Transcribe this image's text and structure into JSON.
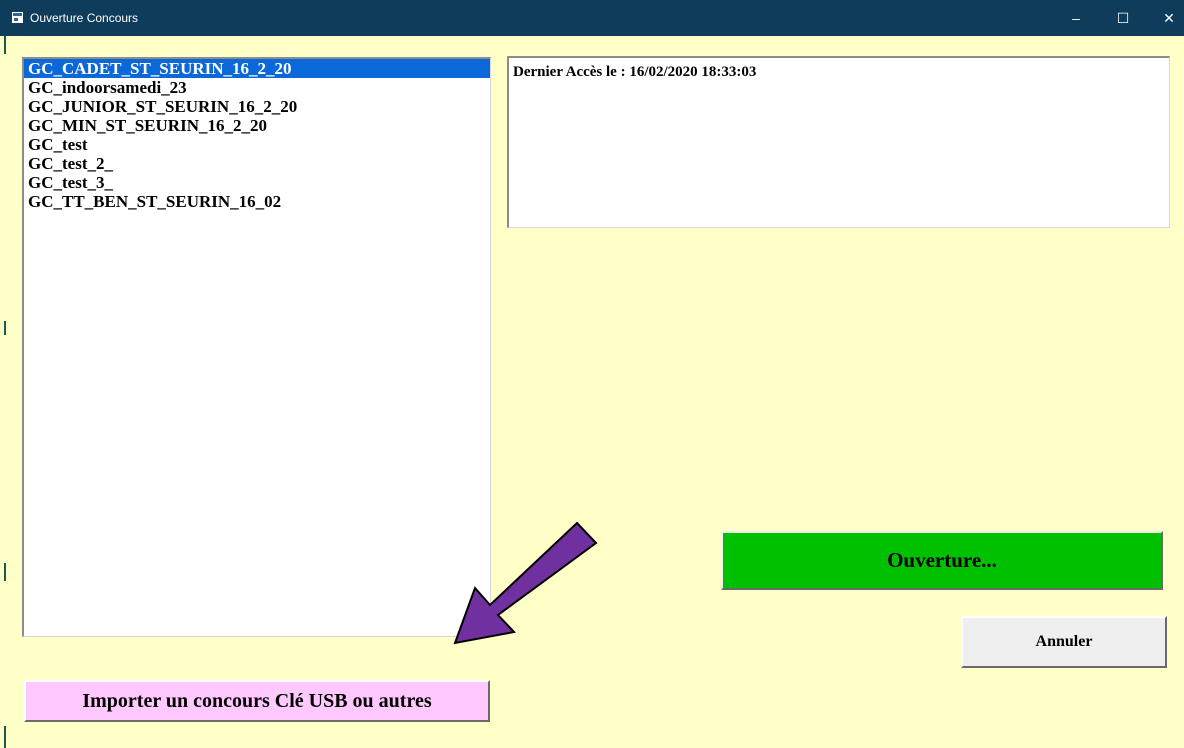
{
  "window": {
    "title": "Ouverture Concours",
    "minimize_glyph": "–",
    "maximize_glyph": "☐",
    "close_glyph": "✕"
  },
  "concours_list": {
    "selected_index": 0,
    "items": [
      "GC_CADET_ST_SEURIN_16_2_20",
      "GC_indoorsamedi_23",
      "GC_JUNIOR_ST_SEURIN_16_2_20",
      "GC_MIN_ST_SEURIN_16_2_20",
      "GC_test",
      "GC_test_2_",
      "GC_test_3_",
      "GC_TT_BEN_ST_SEURIN_16_02"
    ]
  },
  "info": {
    "last_access": "Dernier Accès le : 16/02/2020 18:33:03"
  },
  "buttons": {
    "open_label": "Ouverture...",
    "cancel_label": "Annuler",
    "import_label": "Importer un concours Clé USB ou autres"
  },
  "colors": {
    "background": "#ffffc8",
    "titlebar": "#0f3c5a",
    "selection": "#0a68d8",
    "open_button": "#00c000",
    "import_button": "#ffc8ff",
    "arrow": "#7030a0"
  },
  "annotation": {
    "arrow_icon": "annotation-arrow-icon"
  }
}
